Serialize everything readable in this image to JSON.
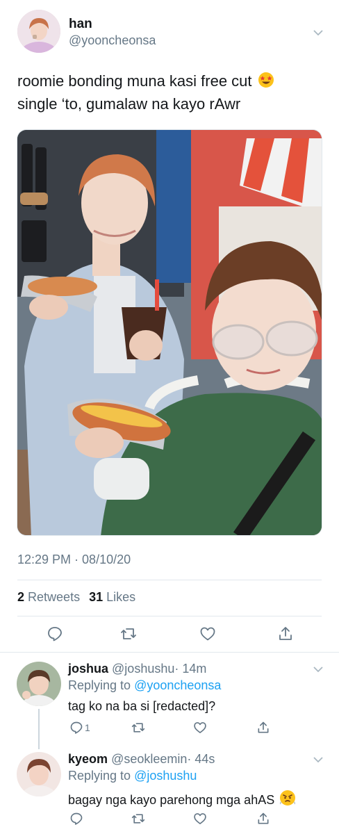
{
  "tweet": {
    "author_name": "han",
    "author_handle": "@yooncheonsa",
    "text_line1": "roomie bonding muna kasi free cut",
    "text_line2": "single ‘to, gumalaw na kayo rAwr",
    "timestamp": "12:29 PM · 08/10/20",
    "retweets_count": "2",
    "retweets_label": "Retweets",
    "likes_count": "31",
    "likes_label": "Likes"
  },
  "replies": [
    {
      "name": "joshua",
      "handle": "@joshushu",
      "time": "· 14m",
      "replying_prefix": "Replying to",
      "replying_to": "@yooncheonsa",
      "text": "tag ko na ba si [redacted]?",
      "reply_count": "1"
    },
    {
      "name": "kyeom",
      "handle": "@seokleemin",
      "time": "· 44s",
      "replying_prefix": "Replying to",
      "replying_to": "@joshushu",
      "text": "bagay nga kayo parehong mga ahAS"
    }
  ],
  "colors": {
    "link": "#1da1f2",
    "secondary_text": "#657786",
    "divider": "#e1e8ed"
  },
  "icons": [
    "chevron-down-icon",
    "reply-icon",
    "retweet-icon",
    "like-icon",
    "share-icon",
    "star-struck-emoji",
    "huffing-emoji"
  ]
}
